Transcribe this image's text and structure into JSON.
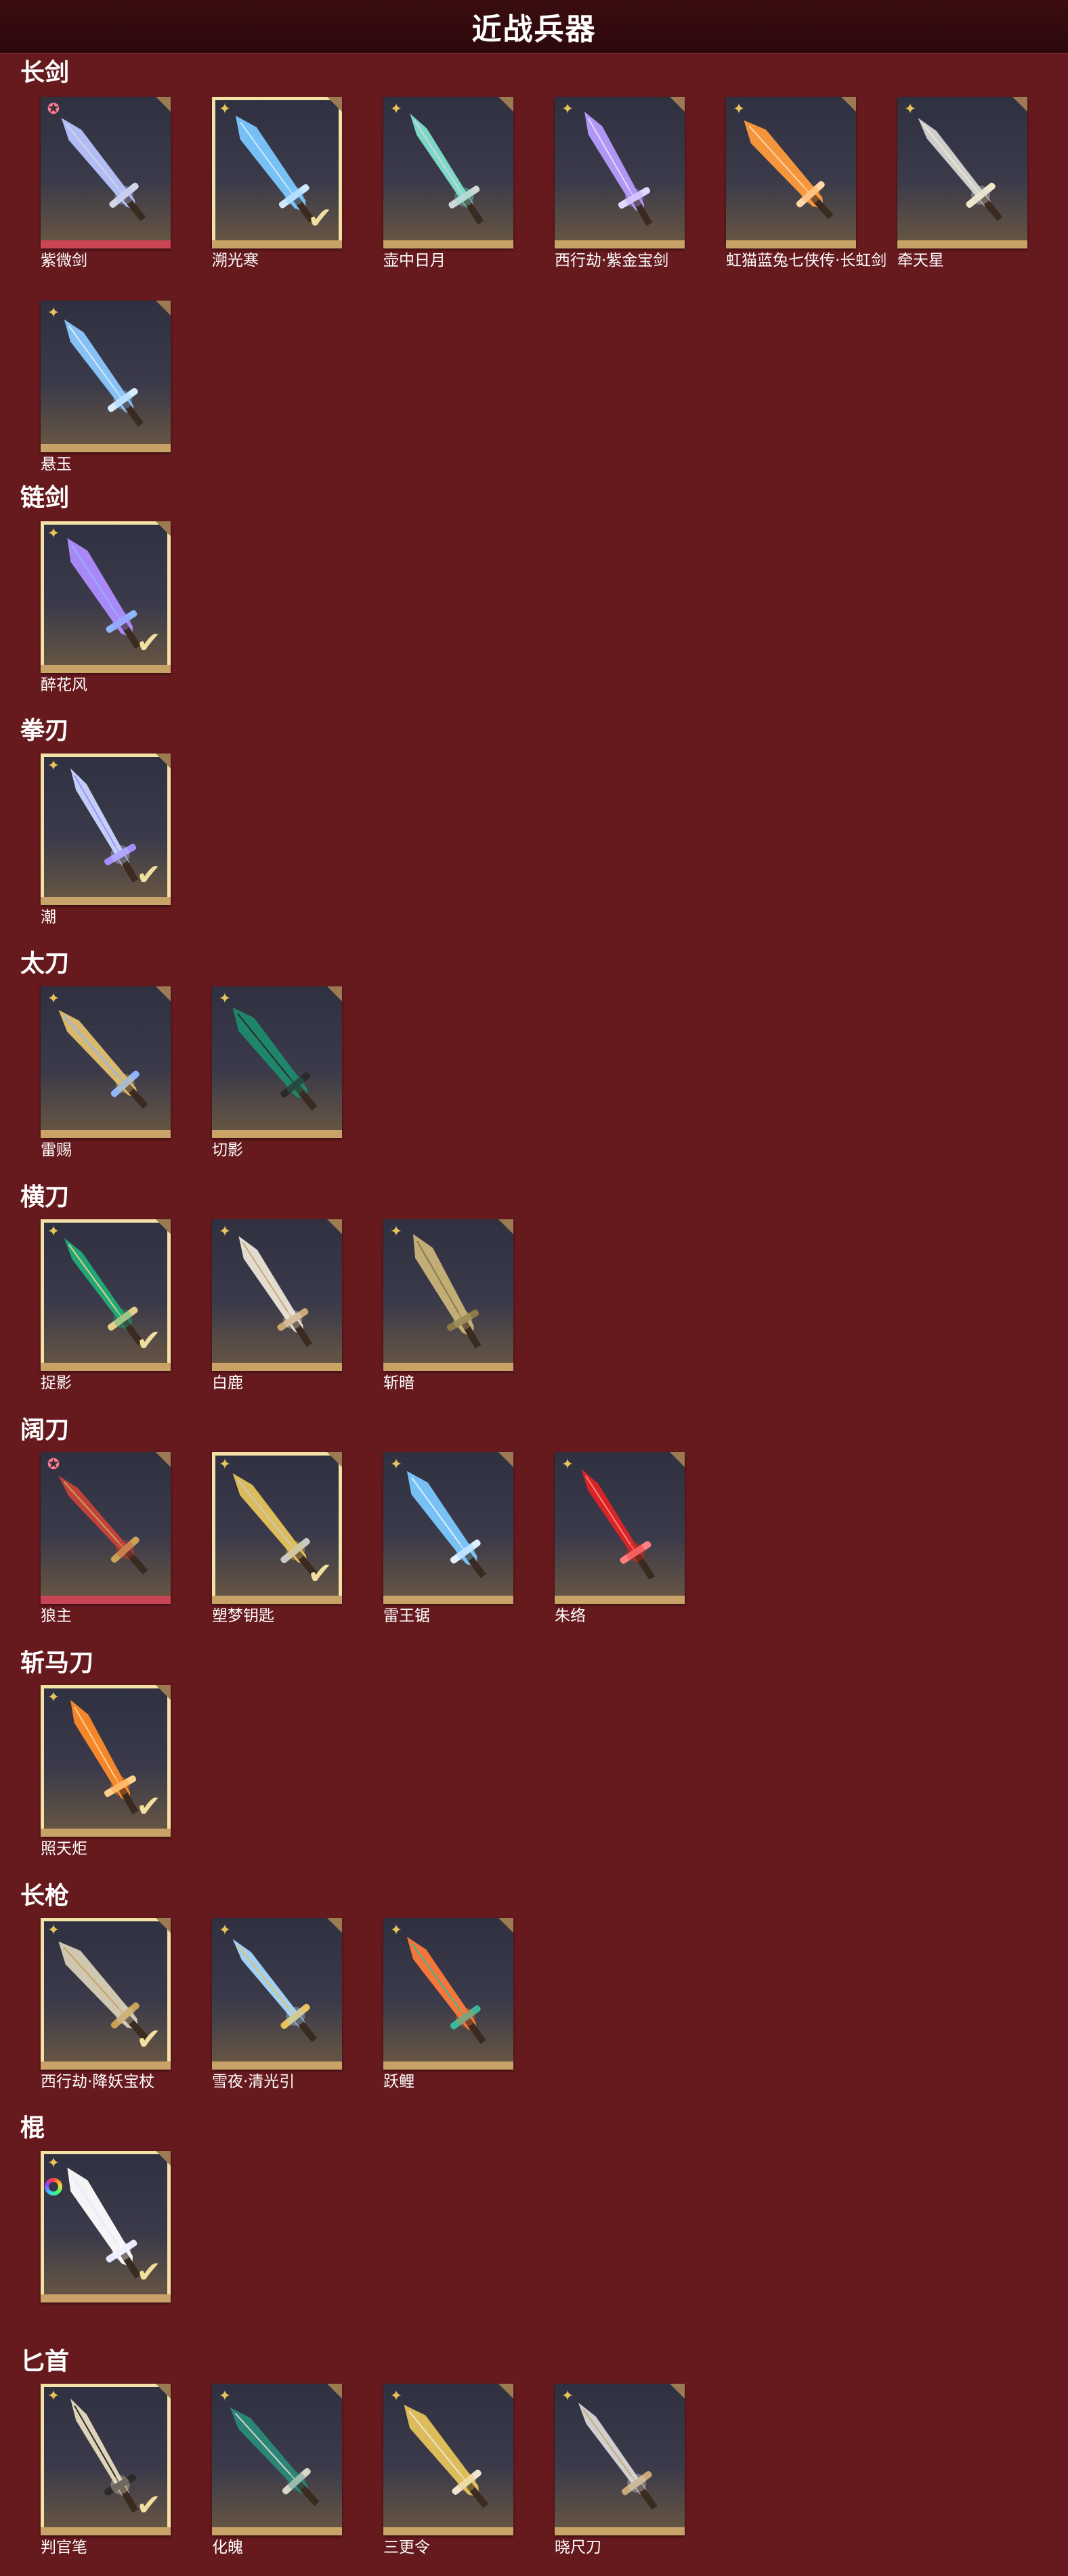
{
  "header": {
    "title": "近战兵器"
  },
  "categories": {
    "longsword": {
      "title": "长剑",
      "items": [
        {
          "name": "紫微剑",
          "star": "✪",
          "rarity": "red",
          "selected": false,
          "icon": "purple-gold-sword-icon",
          "colors": [
            "#b8c4ff",
            "#d0d6e6"
          ]
        },
        {
          "name": "溯光寒",
          "star": "✦",
          "rarity": "gold",
          "selected": true,
          "icon": "ice-blue-sword-icon",
          "colors": [
            "#7ac8ff",
            "#cfeaff"
          ]
        },
        {
          "name": "壶中日月",
          "star": "✦",
          "rarity": "gold",
          "selected": false,
          "icon": "jade-sword-icon",
          "colors": [
            "#7fe0d0",
            "#cfd8d6"
          ]
        },
        {
          "name": "西行劫·紫金宝剑",
          "star": "✦",
          "rarity": "gold",
          "selected": false,
          "icon": "violet-sword-icon",
          "colors": [
            "#b79cff",
            "#e2d8ff"
          ]
        },
        {
          "name": "虹猫蓝兔七侠传·长虹剑",
          "star": "✦",
          "rarity": "gold",
          "selected": false,
          "icon": "orange-sword-icon",
          "colors": [
            "#ff9a3c",
            "#ffd7a8"
          ]
        },
        {
          "name": "牵天星",
          "star": "✦",
          "rarity": "gold",
          "selected": false,
          "icon": "silver-sword-icon",
          "colors": [
            "#d6d6d6",
            "#f0e6c8"
          ]
        },
        {
          "name": "悬玉",
          "star": "✦",
          "rarity": "gold",
          "selected": false,
          "icon": "blue-steel-sword-icon",
          "colors": [
            "#8cc8ff",
            "#d8ecff"
          ]
        }
      ]
    },
    "chainsword": {
      "title": "链剑",
      "items": [
        {
          "name": "醉花风",
          "star": "✦",
          "rarity": "gold",
          "selected": true,
          "icon": "chain-sword-icon",
          "colors": [
            "#b08cff",
            "#8fb6ff"
          ]
        }
      ]
    },
    "fistblade": {
      "title": "拳刃",
      "items": [
        {
          "name": "潮",
          "star": "✦",
          "rarity": "gold",
          "selected": true,
          "icon": "claw-blade-icon",
          "colors": [
            "#c9d8ff",
            "#a58cff"
          ]
        }
      ]
    },
    "tachi": {
      "title": "太刀",
      "items": [
        {
          "name": "雷赐",
          "star": "✦",
          "rarity": "gold",
          "selected": false,
          "icon": "golden-tachi-icon",
          "colors": [
            "#e0c070",
            "#8fb6ff"
          ]
        },
        {
          "name": "切影",
          "star": "✦",
          "rarity": "gold",
          "selected": false,
          "icon": "dark-green-tachi-icon",
          "colors": [
            "#1e8a6e",
            "#2a2a2a"
          ]
        }
      ]
    },
    "hengdao": {
      "title": "横刀",
      "items": [
        {
          "name": "捉影",
          "star": "✦",
          "rarity": "gold",
          "selected": true,
          "icon": "emerald-saber-icon",
          "colors": [
            "#1fae7a",
            "#e4d08a"
          ]
        },
        {
          "name": "白鹿",
          "star": "✦",
          "rarity": "gold",
          "selected": false,
          "icon": "white-saber-icon",
          "colors": [
            "#ece6d8",
            "#c9a878"
          ]
        },
        {
          "name": "斩暗",
          "star": "✦",
          "rarity": "gold",
          "selected": false,
          "icon": "bronze-saber-icon",
          "colors": [
            "#c9b478",
            "#8a7a4a"
          ]
        }
      ]
    },
    "broadblade": {
      "title": "阔刀",
      "items": [
        {
          "name": "狼主",
          "star": "✪",
          "rarity": "red",
          "selected": false,
          "icon": "wolf-blade-icon",
          "colors": [
            "#c9423a",
            "#c9a258"
          ]
        },
        {
          "name": "塑梦钥匙",
          "star": "✦",
          "rarity": "gold",
          "selected": true,
          "icon": "key-blade-icon",
          "colors": [
            "#e6c35c",
            "#c8c8c8"
          ]
        },
        {
          "name": "雷王锯",
          "star": "✦",
          "rarity": "gold",
          "selected": false,
          "icon": "lightning-blade-icon",
          "colors": [
            "#7ac8ff",
            "#e0f0ff"
          ]
        },
        {
          "name": "朱络",
          "star": "✦",
          "rarity": "gold",
          "selected": false,
          "icon": "crimson-blade-icon",
          "colors": [
            "#e02424",
            "#ff8080"
          ]
        }
      ]
    },
    "zhanmadao": {
      "title": "斩马刀",
      "items": [
        {
          "name": "照天炬",
          "star": "✦",
          "rarity": "gold",
          "selected": true,
          "icon": "flame-blade-icon",
          "colors": [
            "#ff8a2a",
            "#ffd08a"
          ]
        }
      ]
    },
    "spear": {
      "title": "长枪",
      "items": [
        {
          "name": "西行劫·降妖宝杖",
          "star": "✦",
          "rarity": "gold",
          "selected": true,
          "icon": "staff-spear-icon",
          "colors": [
            "#d8d0b8",
            "#c9a258"
          ]
        },
        {
          "name": "雪夜·清光引",
          "star": "✦",
          "rarity": "gold",
          "selected": false,
          "icon": "ice-spear-icon",
          "colors": [
            "#a8d8ff",
            "#e6c35c"
          ]
        },
        {
          "name": "跃鲤",
          "star": "✦",
          "rarity": "gold",
          "selected": false,
          "icon": "koi-spear-icon",
          "colors": [
            "#ff7a3a",
            "#3ab89a"
          ]
        }
      ]
    },
    "staff": {
      "title": "棍",
      "items": [
        {
          "name": "",
          "star": "✦",
          "rarity": "gold",
          "selected": true,
          "icon": "light-staff-icon",
          "colors": [
            "#ffffff",
            "#e8e8ff"
          ],
          "rainbow": true
        }
      ]
    },
    "dagger": {
      "title": "匕首",
      "items": [
        {
          "name": "判官笔",
          "star": "✦",
          "rarity": "gold",
          "selected": true,
          "icon": "brush-dagger-icon",
          "colors": [
            "#e8dcc0",
            "#2a2a2a"
          ]
        },
        {
          "name": "化魄",
          "star": "✦",
          "rarity": "gold",
          "selected": false,
          "icon": "curved-dagger-icon",
          "colors": [
            "#2a8a7a",
            "#d8d8c8"
          ]
        },
        {
          "name": "三更令",
          "star": "✦",
          "rarity": "gold",
          "selected": false,
          "icon": "gold-dagger-icon",
          "colors": [
            "#e6c35c",
            "#f0e6d0"
          ]
        },
        {
          "name": "晓尺刀",
          "star": "✦",
          "rarity": "gold",
          "selected": false,
          "icon": "silver-dagger-icon",
          "colors": [
            "#d8d8d8",
            "#c9a878"
          ]
        }
      ]
    }
  }
}
